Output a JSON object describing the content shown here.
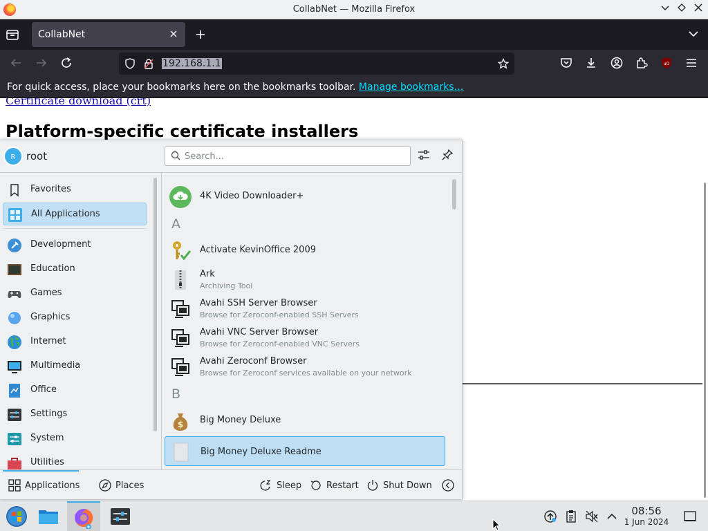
{
  "window": {
    "title": "CollabNet — Mozilla Firefox"
  },
  "tabs": [
    {
      "title": "CollabNet"
    }
  ],
  "urlbar": {
    "url": "192.168.1.1"
  },
  "bookmarks_bar": {
    "message": "For quick access, place your bookmarks here on the bookmarks toolbar.",
    "link": "Manage bookmarks…"
  },
  "page": {
    "cert_link": "Certificate download (crt)",
    "heading": "Platform-specific certificate installers"
  },
  "launcher": {
    "user": "root",
    "avatar_initial": "R",
    "search_placeholder": "Search...",
    "categories": [
      {
        "label": "Favorites",
        "icon": "bookmark-icon"
      },
      {
        "label": "All Applications",
        "icon": "grid-icon",
        "active": true
      },
      {
        "label": "Development",
        "icon": "development-icon"
      },
      {
        "label": "Education",
        "icon": "education-icon"
      },
      {
        "label": "Games",
        "icon": "gamepad-icon"
      },
      {
        "label": "Graphics",
        "icon": "graphics-icon"
      },
      {
        "label": "Internet",
        "icon": "globe-icon"
      },
      {
        "label": "Multimedia",
        "icon": "multimedia-icon"
      },
      {
        "label": "Office",
        "icon": "office-icon"
      },
      {
        "label": "Settings",
        "icon": "settings-icon"
      },
      {
        "label": "System",
        "icon": "system-icon"
      },
      {
        "label": "Utilities",
        "icon": "toolbox-icon"
      }
    ],
    "letters": {
      "a": "A",
      "b": "B"
    },
    "apps": [
      {
        "name": "4K Video Downloader+",
        "desc": "",
        "icon": "cloud-download-icon"
      },
      {
        "name": "Activate KevinOffice 2009",
        "desc": "",
        "icon": "key-check-icon"
      },
      {
        "name": "Ark",
        "desc": "Archiving Tool",
        "icon": "archive-icon"
      },
      {
        "name": "Avahi SSH Server Browser",
        "desc": "Browse for Zeroconf-enabled SSH Servers",
        "icon": "network-computer-icon"
      },
      {
        "name": "Avahi VNC Server Browser",
        "desc": "Browse for Zeroconf-enabled VNC Servers",
        "icon": "network-computer-icon"
      },
      {
        "name": "Avahi Zeroconf Browser",
        "desc": "Browse for Zeroconf services available on your network",
        "icon": "network-computer-icon"
      },
      {
        "name": "Big Money Deluxe",
        "desc": "",
        "icon": "money-bag-icon"
      },
      {
        "name": "Big Money Deluxe Readme",
        "desc": "",
        "icon": "document-icon",
        "active": true
      }
    ],
    "footer": {
      "applications": "Applications",
      "places": "Places",
      "sleep": "Sleep",
      "restart": "Restart",
      "shutdown": "Shut Down"
    }
  },
  "taskbar": {
    "clock_time": "08:56",
    "clock_date": "1 Jun 2024"
  },
  "colors": {
    "accent": "#3daee9",
    "selection": "#c2e0f5",
    "firefox_dark": "#2b2a33"
  }
}
